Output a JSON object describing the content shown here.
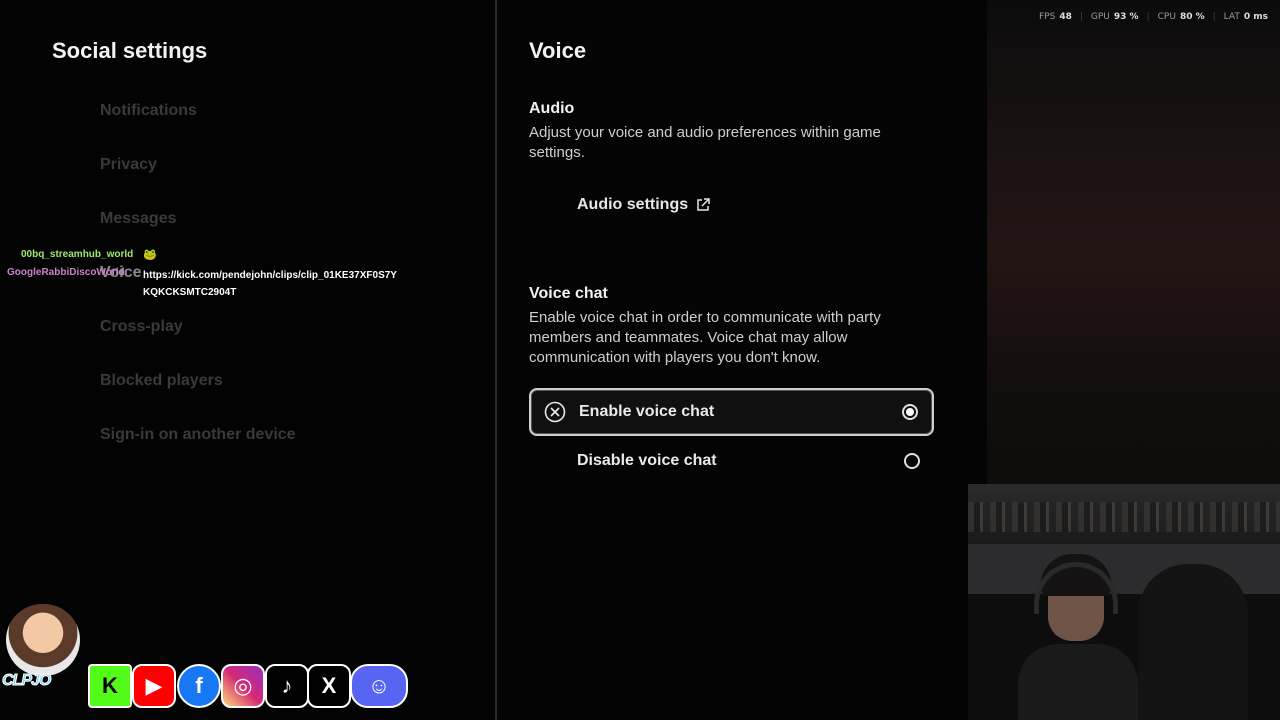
{
  "left": {
    "title": "Social settings",
    "nav": [
      {
        "label": "Notifications"
      },
      {
        "label": "Privacy"
      },
      {
        "label": "Messages"
      },
      {
        "label": "Voice"
      },
      {
        "label": "Cross-play"
      },
      {
        "label": "Blocked players"
      },
      {
        "label": "Sign-in on another device"
      }
    ]
  },
  "right": {
    "title": "Voice",
    "audio": {
      "title": "Audio",
      "desc": "Adjust your voice and audio preferences within game settings.",
      "button": "Audio settings",
      "button_icon": "external-link-icon"
    },
    "voice_chat": {
      "title": "Voice chat",
      "desc": "Enable voice chat in order to communicate with party members and teammates. Voice chat may allow communication with players you don't know.",
      "options": [
        {
          "label": "Enable voice chat",
          "selected": true,
          "icon": "close-circle-icon"
        },
        {
          "label": "Disable voice chat",
          "selected": false
        }
      ]
    }
  },
  "stats": {
    "fps_label": "FPS",
    "fps": "48",
    "gpu_label": "GPU",
    "gpu": "93 %",
    "cpu_label": "CPU",
    "cpu": "80 %",
    "lat_label": "LAT",
    "lat": "0 ms"
  },
  "chat": {
    "user1": "00bq_streamhub_world",
    "user1_emote": "🐸",
    "user2": "GoogleRabbiDiscoWorld",
    "message": "https://kick.com/pendejohn/clips/clip_01KE37XF0S7YKQKCKSMTC2904T"
  },
  "branding": {
    "name": "CLPJO",
    "socials": [
      "kick-icon",
      "youtube-icon",
      "facebook-icon",
      "instagram-icon",
      "tiktok-icon",
      "x-icon",
      "discord-icon"
    ]
  },
  "colors": {
    "background": "#000000",
    "nav_inactive": "#3a3a3a",
    "chat_user1": "#9fe870",
    "chat_user2": "#c983c9"
  }
}
